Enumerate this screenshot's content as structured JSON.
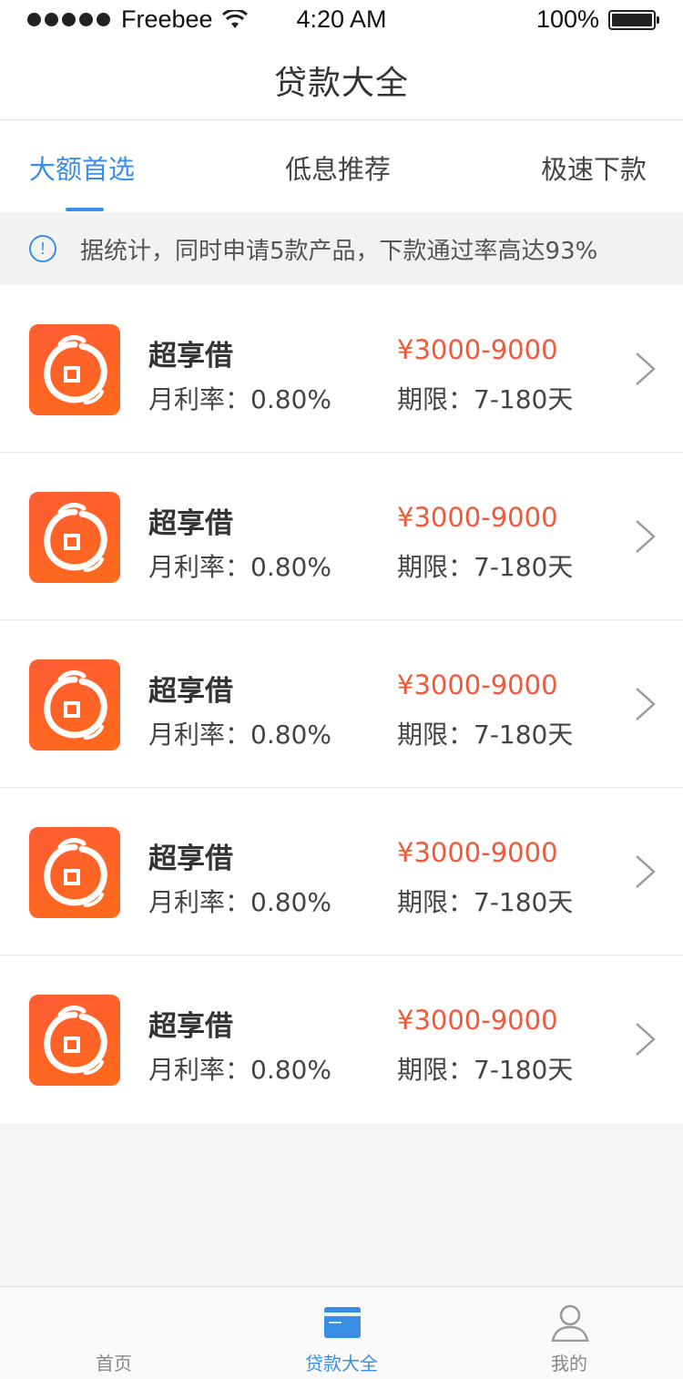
{
  "status_bar": {
    "carrier": "Freebee",
    "time": "4:20 AM",
    "battery": "100%"
  },
  "nav": {
    "title": "贷款大全"
  },
  "tabs": [
    {
      "label": "大额首选",
      "active": true
    },
    {
      "label": "低息推荐",
      "active": false
    },
    {
      "label": "极速下款",
      "active": false
    }
  ],
  "notice": {
    "text": "据统计，同时申请5款产品，下款通过率高达93%"
  },
  "products": [
    {
      "name": "超享借",
      "rate": "月利率：0.80%",
      "amount": "¥3000-9000",
      "term": "期限：7-180天"
    },
    {
      "name": "超享借",
      "rate": "月利率：0.80%",
      "amount": "¥3000-9000",
      "term": "期限：7-180天"
    },
    {
      "name": "超享借",
      "rate": "月利率：0.80%",
      "amount": "¥3000-9000",
      "term": "期限：7-180天"
    },
    {
      "name": "超享借",
      "rate": "月利率：0.80%",
      "amount": "¥3000-9000",
      "term": "期限：7-180天"
    },
    {
      "name": "超享借",
      "rate": "月利率：0.80%",
      "amount": "¥3000-9000",
      "term": "期限：7-180天"
    }
  ],
  "tabbar": [
    {
      "label": "首页",
      "icon": "home-icon",
      "active": false
    },
    {
      "label": "贷款大全",
      "icon": "card-icon",
      "active": true
    },
    {
      "label": "我的",
      "icon": "user-icon",
      "active": false
    }
  ],
  "colors": {
    "accent": "#3a8ee6",
    "amount": "#f05a3a",
    "logo": "#ff5c33"
  }
}
